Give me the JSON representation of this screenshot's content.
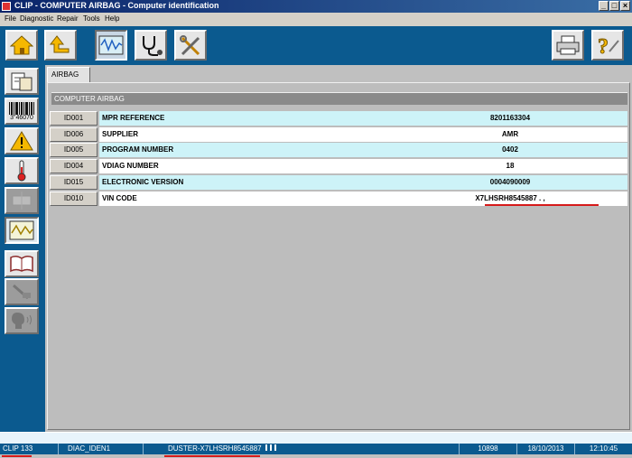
{
  "window": {
    "title": "CLIP - COMPUTER AIRBAG - Computer identification"
  },
  "menu": [
    "File",
    "Diagnostic",
    "Repair",
    "Tools",
    "Help"
  ],
  "toolbar": {
    "buttons": [
      {
        "icon": "home-icon"
      },
      {
        "icon": "up-arrow-icon"
      },
      {
        "icon": "oscilloscope-icon"
      },
      {
        "icon": "stethoscope-icon"
      },
      {
        "icon": "tools-icon"
      },
      {
        "icon": "printer-icon"
      },
      {
        "icon": "help-icon"
      }
    ]
  },
  "sidebar": {
    "buttons": [
      {
        "icon": "document-icon"
      },
      {
        "icon": "barcode-icon",
        "label": "3\"46070"
      },
      {
        "icon": "warning-icon"
      },
      {
        "icon": "thermometer-icon"
      },
      {
        "icon": "disabled-tool-icon"
      },
      {
        "icon": "oscilloscope-icon"
      },
      {
        "icon": "manual-book-icon"
      },
      {
        "icon": "repair-tool-icon"
      },
      {
        "icon": "voice-icon"
      }
    ]
  },
  "tab": {
    "label": "AIRBAG"
  },
  "section": {
    "title": "COMPUTER AIRBAG"
  },
  "rows": [
    {
      "id": "ID001",
      "label": "MPR REFERENCE",
      "value": "8201163304"
    },
    {
      "id": "ID006",
      "label": "SUPPLIER",
      "value": "AMR"
    },
    {
      "id": "ID005",
      "label": "PROGRAM NUMBER",
      "value": "0402"
    },
    {
      "id": "ID004",
      "label": "VDIAG NUMBER",
      "value": "18"
    },
    {
      "id": "ID015",
      "label": "ELECTRONIC VERSION",
      "value": "0004090009"
    },
    {
      "id": "ID010",
      "label": "VIN CODE",
      "value": "X7LHSRH8545887 . ,"
    }
  ],
  "status": {
    "clip": "CLIP 133",
    "module": "DIAC_IDEN1",
    "vehicle": "DUSTER-X7LHSRH8545887",
    "code": "10898",
    "date": "18/10/2013",
    "time": "12:10:45"
  },
  "colors": {
    "toolbar_bg": "#0b5a8f",
    "row_cyan": "#cdf3f8",
    "row_white": "#ffffff",
    "highlight_red": "#d61a1a"
  }
}
